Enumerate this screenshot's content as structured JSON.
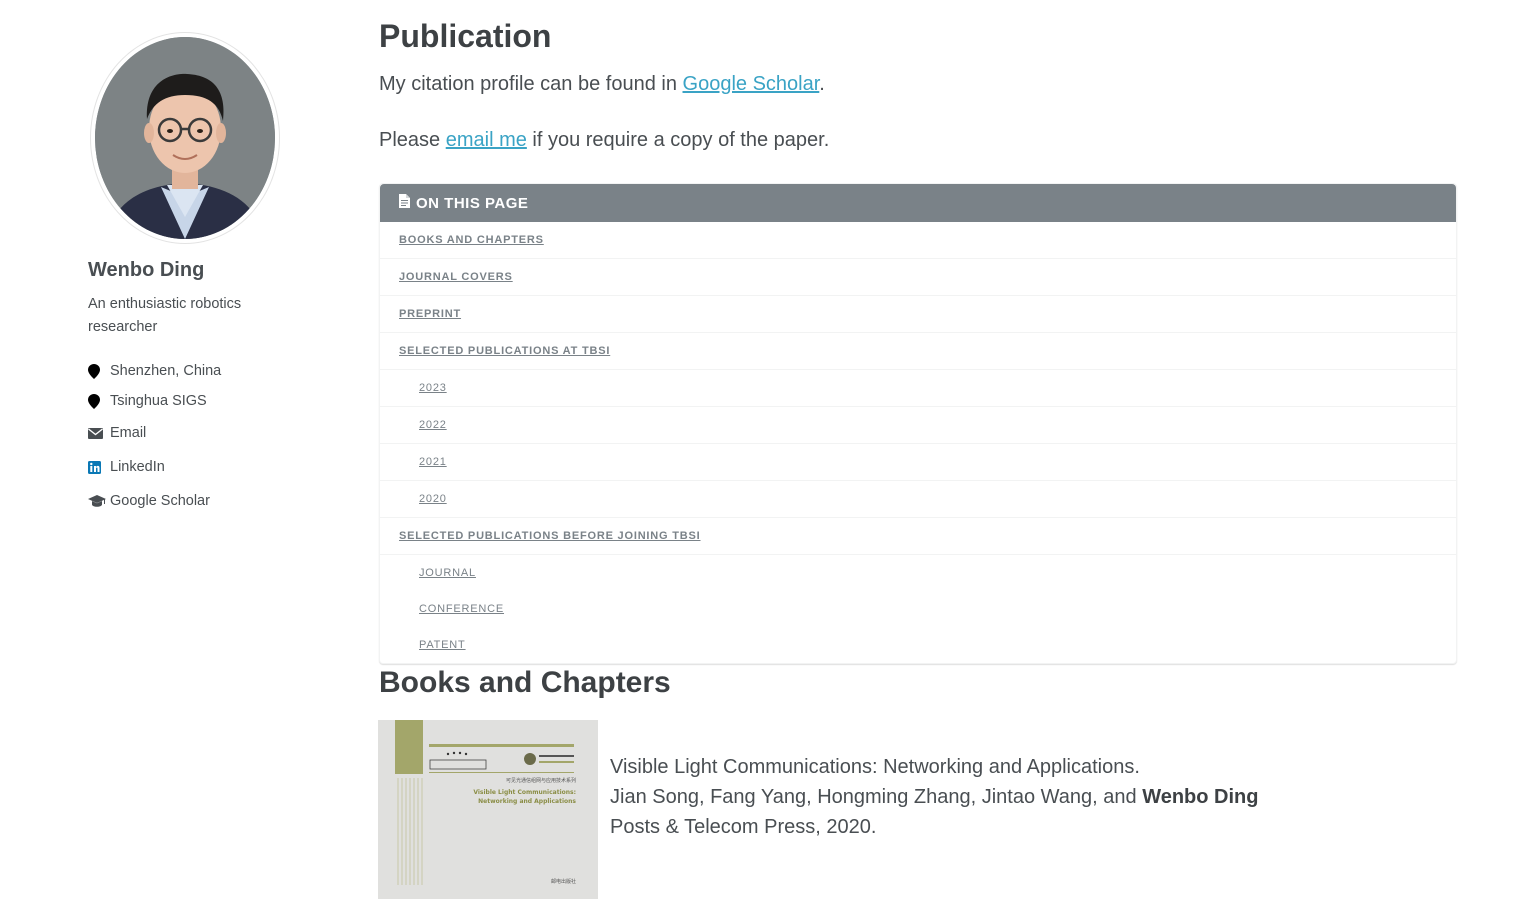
{
  "sidebar": {
    "name": "Wenbo Ding",
    "bio": "An enthusiastic robotics researcher",
    "links": [
      {
        "icon": "location-pin-icon",
        "label": "Shenzhen, China"
      },
      {
        "icon": "location-pin-icon",
        "label": "Tsinghua SIGS"
      },
      {
        "icon": "envelope-icon",
        "label": "Email"
      },
      {
        "icon": "linkedin-icon",
        "label": "LinkedIn"
      },
      {
        "icon": "graduation-cap-icon",
        "label": "Google Scholar"
      }
    ]
  },
  "main": {
    "title": "Publication",
    "citation": {
      "prefix": "My citation profile can be found in ",
      "link": "Google Scholar",
      "suffix": "."
    },
    "email_note": {
      "prefix": "Please ",
      "link": "email me",
      "suffix": " if you require a copy of the paper."
    },
    "toc": {
      "header": "ON THIS PAGE",
      "items": [
        {
          "label": "Books and Chapters",
          "level": 1
        },
        {
          "label": "Journal Covers",
          "level": 1
        },
        {
          "label": "Preprint",
          "level": 1
        },
        {
          "label": "Selected Publications at TBSI",
          "level": 1
        },
        {
          "label": "2023",
          "level": 2
        },
        {
          "label": "2022",
          "level": 2
        },
        {
          "label": "2021",
          "level": 2
        },
        {
          "label": "2020",
          "level": 2
        },
        {
          "label": "Selected Publications Before Joining TBSI",
          "level": 1
        },
        {
          "label": "Journal",
          "level": 2
        },
        {
          "label": "Conference",
          "level": 2
        },
        {
          "label": "Patent",
          "level": 2
        }
      ]
    },
    "books_section": {
      "title": "Books and Chapters",
      "book": {
        "title_line": "Visible Light Communications: Networking and Applications.",
        "authors_prefix": "Jian Song, Fang Yang, Hongming Zhang, Jintao Wang, and ",
        "authors_bold": "Wenbo Ding",
        "publisher": "Posts & Telecom Press, 2020.",
        "cover_text_en": "Visible Light Communications: Networking and Applications",
        "cover_text_cn_1": "可见光通信组网与应用技术系列",
        "cover_text_cn_2": "邮电出版社"
      }
    }
  },
  "colors": {
    "link": "#3aa3c5",
    "toc_header_bg": "#7a8288",
    "text": "#494e52",
    "heading": "#3d4144",
    "cover_accent": "#a3a66a"
  }
}
